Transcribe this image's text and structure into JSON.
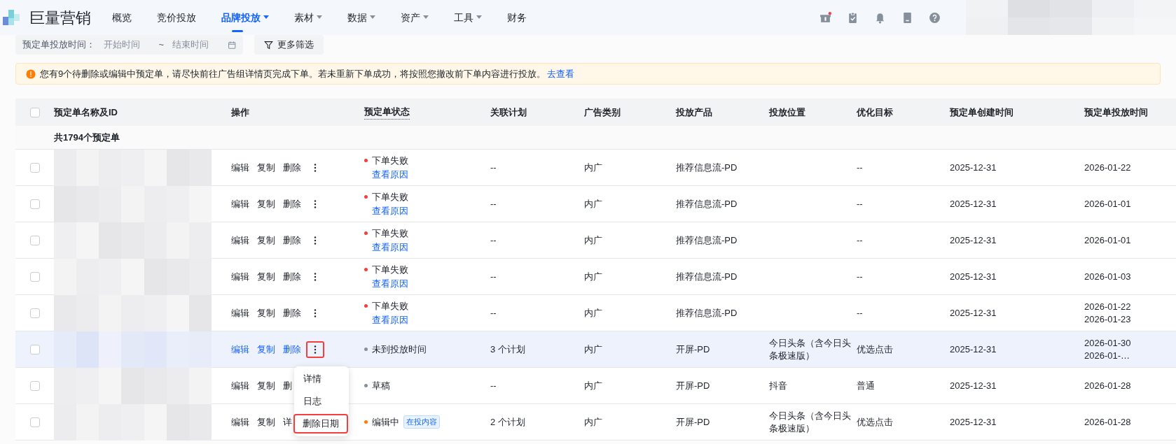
{
  "nav": {
    "brand": "巨量营销",
    "items": [
      {
        "label": "概览",
        "selected": false,
        "has_menu": false
      },
      {
        "label": "竞价投放",
        "selected": false,
        "has_menu": false
      },
      {
        "label": "品牌投放",
        "selected": true,
        "has_menu": true
      },
      {
        "label": "素材",
        "selected": false,
        "has_menu": true
      },
      {
        "label": "数据",
        "selected": false,
        "has_menu": true
      },
      {
        "label": "资产",
        "selected": false,
        "has_menu": true
      },
      {
        "label": "工具",
        "selected": false,
        "has_menu": true
      },
      {
        "label": "财务",
        "selected": false,
        "has_menu": false
      }
    ],
    "gift_badge": true
  },
  "filter": {
    "label": "预定单投放时间：",
    "start_placeholder": "开始时间",
    "separator": "~",
    "end_placeholder": "结束时间",
    "more_button": "更多筛选"
  },
  "notice": {
    "text": "您有9个待删除或编辑中预定单，请尽快前往广告组详情页完成下单。若未重新下单成功，将按照您撤改前下单内容进行投放。",
    "link": "去查看"
  },
  "table": {
    "select_all": {
      "checked": false
    },
    "columns": [
      "预定单名称及ID",
      "操作",
      "预定单状态",
      "关联计划",
      "广告类别",
      "投放产品",
      "投放位置",
      "优化目标",
      "预定单创建时间",
      "预定单投放时间"
    ],
    "count": "共1794个预定单",
    "rows": [
      {
        "checked": false,
        "selected": false,
        "actions": [
          "编辑",
          "复制",
          "删除"
        ],
        "more_button": {
          "highlighted": false
        },
        "status": {
          "text": "下单失败",
          "color": "#f53f3f",
          "link": "查看原因"
        },
        "plan": "--",
        "ad_type": "内广",
        "product": "推荐信息流-PD",
        "goal": "--",
        "created": "2025-12-31",
        "schedule": [
          "2026-01-22"
        ]
      },
      {
        "checked": false,
        "selected": false,
        "actions": [
          "编辑",
          "复制",
          "删除"
        ],
        "more_button": {
          "highlighted": false
        },
        "status": {
          "text": "下单失败",
          "color": "#f53f3f",
          "link": "查看原因"
        },
        "plan": "--",
        "ad_type": "内广",
        "product": "推荐信息流-PD",
        "goal": "--",
        "created": "2025-12-31",
        "schedule": [
          "2026-01-01"
        ]
      },
      {
        "checked": false,
        "selected": false,
        "actions": [
          "编辑",
          "复制",
          "删除"
        ],
        "more_button": {
          "highlighted": false
        },
        "status": {
          "text": "下单失败",
          "color": "#f53f3f",
          "link": "查看原因"
        },
        "plan": "--",
        "ad_type": "内广",
        "product": "推荐信息流-PD",
        "goal": "--",
        "created": "2025-12-31",
        "schedule": [
          "2026-01-01"
        ]
      },
      {
        "checked": false,
        "selected": false,
        "actions": [
          "编辑",
          "复制",
          "删除"
        ],
        "more_button": {
          "highlighted": false
        },
        "status": {
          "text": "下单失败",
          "color": "#f53f3f",
          "link": "查看原因"
        },
        "plan": "--",
        "ad_type": "内广",
        "product": "推荐信息流-PD",
        "goal": "--",
        "created": "2025-12-31",
        "schedule": [
          "2026-01-03"
        ]
      },
      {
        "checked": false,
        "selected": false,
        "actions": [
          "编辑",
          "复制",
          "删除"
        ],
        "more_button": {
          "highlighted": false
        },
        "status": {
          "text": "下单失败",
          "color": "#f53f3f",
          "link": "查看原因"
        },
        "plan": "--",
        "ad_type": "内广",
        "product": "推荐信息流-PD",
        "goal": "--",
        "created": "2025-12-31",
        "schedule": [
          "2026-01-22",
          "2026-01-23"
        ]
      },
      {
        "checked": false,
        "selected": true,
        "actions": [
          "编辑",
          "复制",
          "删除"
        ],
        "more_button": {
          "highlighted": true
        },
        "status": {
          "text": "未到投放时间",
          "color": "#86909c"
        },
        "plan": "3 个计划",
        "ad_type": "内广",
        "product": "开屏-PD",
        "position": "今日头条（含今日头条极速版）",
        "goal": "优选点击",
        "created": "2025-12-31",
        "schedule": [
          "2026-01-30",
          "2026-01-…"
        ]
      },
      {
        "checked": false,
        "selected": false,
        "actions": [
          "编辑",
          "复制",
          "删"
        ],
        "status": {
          "text": "草稿",
          "color": "#86909c"
        },
        "plan": "--",
        "ad_type": "内广",
        "product": "开屏-PD",
        "position": "抖音",
        "goal": "普通",
        "created": "2025-12-31",
        "schedule": [
          "2026-01-28"
        ]
      },
      {
        "checked": false,
        "selected": false,
        "actions": [
          "编辑",
          "复制",
          "详"
        ],
        "status": {
          "text": "编辑中",
          "color": "#ff7d00",
          "tag": "在投内容"
        },
        "plan": "2 个计划",
        "ad_type": "内广",
        "product": "开屏-PD",
        "position": "今日头条（含今日头条极速版）",
        "goal": "优选点击",
        "created": "2025-12-31",
        "schedule": [
          "2026-01-28"
        ]
      }
    ]
  },
  "row_menu": {
    "items": [
      {
        "label": "详情",
        "highlighted": false
      },
      {
        "label": "日志",
        "highlighted": false
      },
      {
        "label": "删除日期",
        "highlighted": true
      }
    ]
  }
}
